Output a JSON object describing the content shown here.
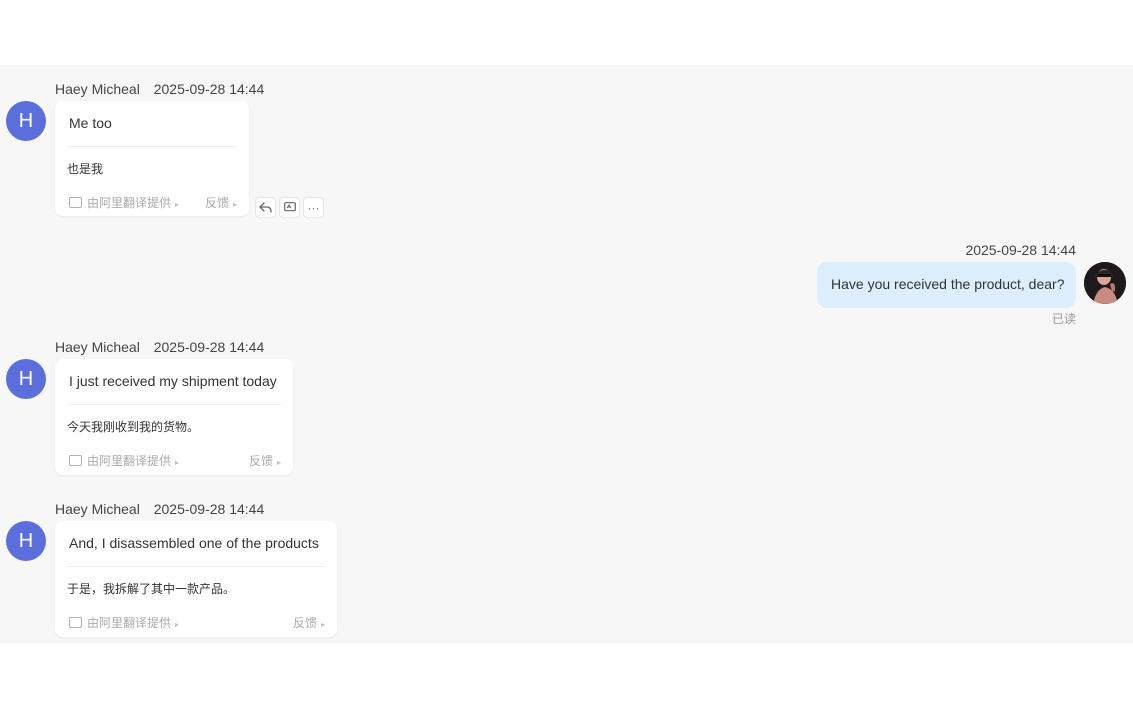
{
  "conversation": {
    "messages": [
      {
        "direction": "incoming",
        "avatar_letter": "H",
        "sender": "Haey Micheal",
        "time": "2025-09-28 14:44",
        "text": "Me too",
        "translation": "也是我",
        "provider": "由阿里翻译提供",
        "feedback": "反馈",
        "actions": [
          "reply-icon",
          "translate-icon",
          "more-icon"
        ],
        "more_label": "···"
      },
      {
        "direction": "outgoing",
        "time": "2025-09-28 14:44",
        "text": "Have you received the product, dear?",
        "status": "已读",
        "avatar": "user-photo"
      },
      {
        "direction": "incoming",
        "avatar_letter": "H",
        "sender": "Haey Micheal",
        "time": "2025-09-28 14:44",
        "text": "I just received my shipment today",
        "translation": "今天我刚收到我的货物。",
        "provider": "由阿里翻译提供",
        "feedback": "反馈"
      },
      {
        "direction": "incoming",
        "avatar_letter": "H",
        "sender": "Haey Micheal",
        "time": "2025-09-28 14:44",
        "text": "And, I disassembled one of the products",
        "translation": "于是，我拆解了其中一款产品。",
        "provider": "由阿里翻译提供",
        "feedback": "反馈"
      }
    ]
  },
  "colors": {
    "chat_background": "#f7f7f7",
    "incoming_avatar": "#5a6fdc",
    "outgoing_bubble": "#ddeeff",
    "incoming_bubble": "#ffffff"
  }
}
